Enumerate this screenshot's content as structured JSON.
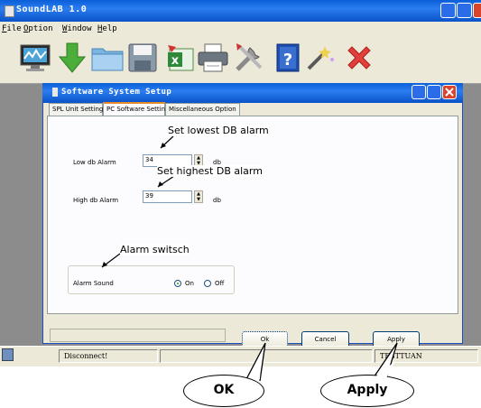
{
  "app": {
    "title": "SoundLAB 1.0"
  },
  "menu": [
    "File",
    "Option",
    "Window",
    "Help"
  ],
  "toolbar": [
    "monitor-icon",
    "download-arrow-icon",
    "folder-icon",
    "save-icon",
    "excel-export-icon",
    "printer-icon",
    "tools-icon",
    "help-icon",
    "magic-wand-icon",
    "close-x-icon"
  ],
  "dialog": {
    "title": "Software System Setup",
    "tabs": [
      "SPL Unit Setting",
      "PC Software Setting",
      "Miscellaneous Option"
    ],
    "low_label": "Low db Alarm",
    "low_value": "34",
    "high_label": "High db Alarm",
    "high_value": "39",
    "unit": "db",
    "alarm_label": "Alarm Sound",
    "on_label": "On",
    "off_label": "Off",
    "ok": "Ok",
    "cancel": "Cancel",
    "apply": "Apply"
  },
  "status": {
    "left": "Disconnect!",
    "right": "TESTTUAN"
  },
  "annotations": {
    "low": "Set lowest DB alarm",
    "high": "Set highest DB alarm",
    "switch": "Alarm switsch",
    "ok": "OK",
    "apply": "Apply"
  },
  "colors": {
    "titlebar": "#0a5fd8",
    "close": "#d9442c",
    "active_tab": "#e68b2c"
  }
}
